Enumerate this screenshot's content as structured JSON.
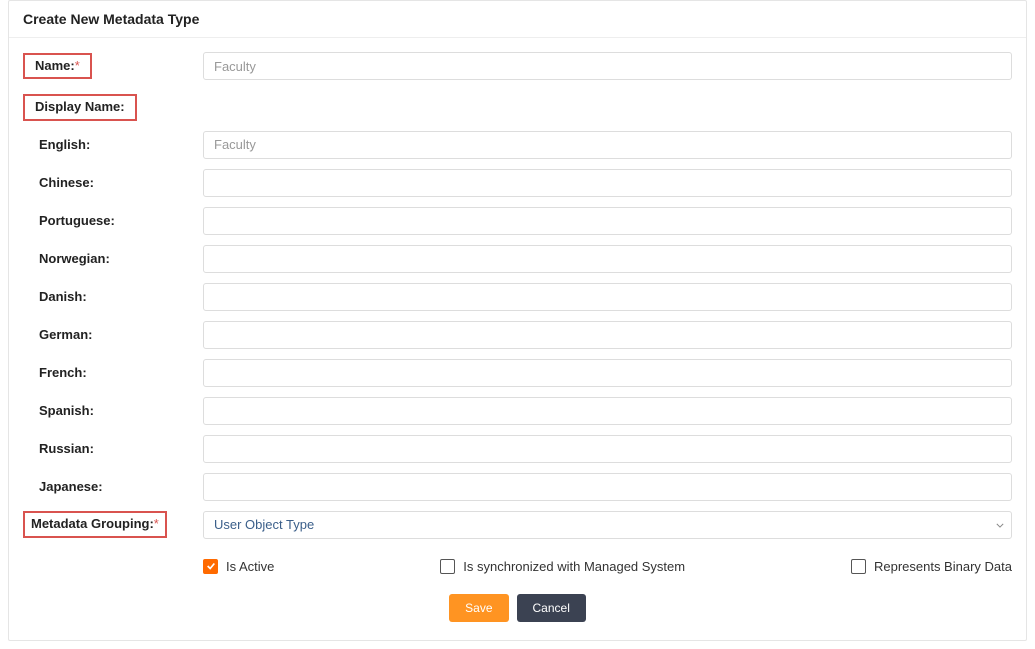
{
  "header": {
    "title": "Create New Metadata Type"
  },
  "labels": {
    "name": "Name:",
    "displayName": "Display Name:",
    "metadataGrouping": "Metadata Grouping:"
  },
  "fields": {
    "name": {
      "placeholder": "Faculty",
      "value": ""
    },
    "displayNames": [
      {
        "label": "English:",
        "placeholder": "Faculty",
        "value": ""
      },
      {
        "label": "Chinese:",
        "placeholder": "",
        "value": ""
      },
      {
        "label": "Portuguese:",
        "placeholder": "",
        "value": ""
      },
      {
        "label": "Norwegian:",
        "placeholder": "",
        "value": ""
      },
      {
        "label": "Danish:",
        "placeholder": "",
        "value": ""
      },
      {
        "label": "German:",
        "placeholder": "",
        "value": ""
      },
      {
        "label": "French:",
        "placeholder": "",
        "value": ""
      },
      {
        "label": "Spanish:",
        "placeholder": "",
        "value": ""
      },
      {
        "label": "Russian:",
        "placeholder": "",
        "value": ""
      },
      {
        "label": "Japanese:",
        "placeholder": "",
        "value": ""
      }
    ],
    "metadataGrouping": {
      "selected": "User Object Type"
    }
  },
  "checkboxes": {
    "isActive": {
      "label": "Is Active",
      "checked": true
    },
    "isSync": {
      "label": "Is synchronized with Managed System",
      "checked": false
    },
    "binaryData": {
      "label": "Represents Binary Data",
      "checked": false
    }
  },
  "buttons": {
    "save": "Save",
    "cancel": "Cancel"
  }
}
